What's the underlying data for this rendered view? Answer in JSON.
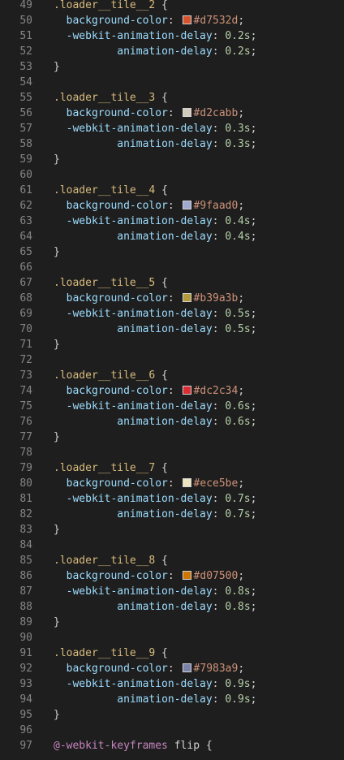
{
  "editor": {
    "lines": [
      {
        "n": "49",
        "kind": "sel",
        "text": ".loader__tile__2"
      },
      {
        "n": "50",
        "kind": "bg",
        "color": "#d7532d"
      },
      {
        "n": "51",
        "kind": "wk",
        "value": "0.2s"
      },
      {
        "n": "52",
        "kind": "ad",
        "value": "0.2s"
      },
      {
        "n": "53",
        "kind": "close"
      },
      {
        "n": "54",
        "kind": "blank"
      },
      {
        "n": "55",
        "kind": "sel",
        "text": ".loader__tile__3"
      },
      {
        "n": "56",
        "kind": "bg",
        "color": "#d2cabb"
      },
      {
        "n": "57",
        "kind": "wk",
        "value": "0.3s"
      },
      {
        "n": "58",
        "kind": "ad",
        "value": "0.3s"
      },
      {
        "n": "59",
        "kind": "close"
      },
      {
        "n": "60",
        "kind": "blank"
      },
      {
        "n": "61",
        "kind": "sel",
        "text": ".loader__tile__4"
      },
      {
        "n": "62",
        "kind": "bg",
        "color": "#9faad0"
      },
      {
        "n": "63",
        "kind": "wk",
        "value": "0.4s"
      },
      {
        "n": "64",
        "kind": "ad",
        "value": "0.4s"
      },
      {
        "n": "65",
        "kind": "close"
      },
      {
        "n": "66",
        "kind": "blank"
      },
      {
        "n": "67",
        "kind": "sel",
        "text": ".loader__tile__5"
      },
      {
        "n": "68",
        "kind": "bg",
        "color": "#b39a3b"
      },
      {
        "n": "69",
        "kind": "wk",
        "value": "0.5s"
      },
      {
        "n": "70",
        "kind": "ad",
        "value": "0.5s"
      },
      {
        "n": "71",
        "kind": "close"
      },
      {
        "n": "72",
        "kind": "blank"
      },
      {
        "n": "73",
        "kind": "sel",
        "text": ".loader__tile__6"
      },
      {
        "n": "74",
        "kind": "bg",
        "color": "#dc2c34"
      },
      {
        "n": "75",
        "kind": "wk",
        "value": "0.6s"
      },
      {
        "n": "76",
        "kind": "ad",
        "value": "0.6s"
      },
      {
        "n": "77",
        "kind": "close"
      },
      {
        "n": "78",
        "kind": "blank"
      },
      {
        "n": "79",
        "kind": "sel",
        "text": ".loader__tile__7"
      },
      {
        "n": "80",
        "kind": "bg",
        "color": "#ece5be"
      },
      {
        "n": "81",
        "kind": "wk",
        "value": "0.7s"
      },
      {
        "n": "82",
        "kind": "ad",
        "value": "0.7s"
      },
      {
        "n": "83",
        "kind": "close"
      },
      {
        "n": "84",
        "kind": "blank"
      },
      {
        "n": "85",
        "kind": "sel",
        "text": ".loader__tile__8"
      },
      {
        "n": "86",
        "kind": "bg",
        "color": "#d07500"
      },
      {
        "n": "87",
        "kind": "wk",
        "value": "0.8s"
      },
      {
        "n": "88",
        "kind": "ad",
        "value": "0.8s"
      },
      {
        "n": "89",
        "kind": "close"
      },
      {
        "n": "90",
        "kind": "blank"
      },
      {
        "n": "91",
        "kind": "sel",
        "text": ".loader__tile__9"
      },
      {
        "n": "92",
        "kind": "bg",
        "color": "#7983a9"
      },
      {
        "n": "93",
        "kind": "wk",
        "value": "0.9s"
      },
      {
        "n": "94",
        "kind": "ad",
        "value": "0.9s"
      },
      {
        "n": "95",
        "kind": "close"
      },
      {
        "n": "96",
        "kind": "blank"
      },
      {
        "n": "97",
        "kind": "kf",
        "keyword": "@-webkit-keyframes",
        "name": "flip"
      }
    ]
  }
}
